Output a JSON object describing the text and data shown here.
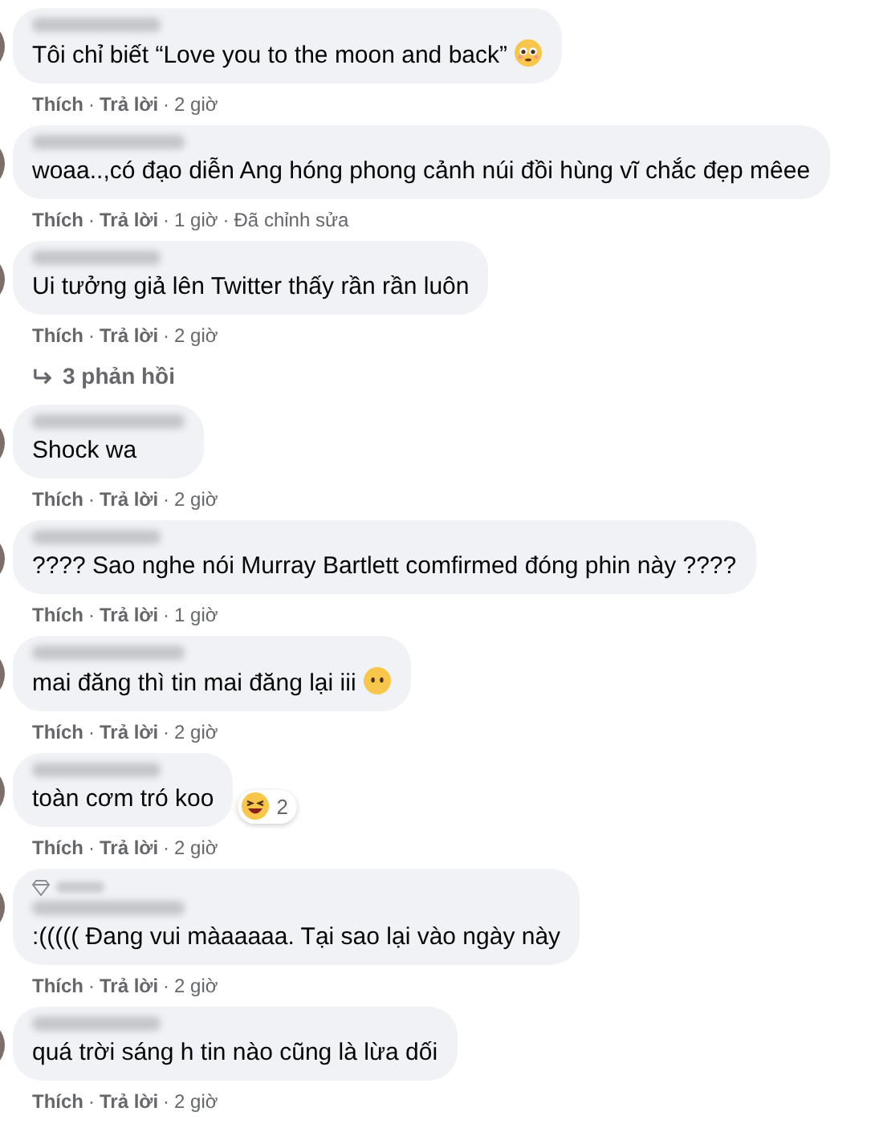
{
  "comments": [
    {
      "text": "Tôi chỉ biết “Love you to the moon and back”",
      "emoji": {
        "kind": "flushed"
      },
      "like": "Thích",
      "reply": "Trả lời",
      "time": "2 giờ",
      "separators": [
        "·",
        "·"
      ]
    },
    {
      "text": "woaa..,có đạo diễn Ang hóng phong cảnh núi đồi hùng vĩ chắc đẹp mêee",
      "like": "Thích",
      "reply": "Trả lời",
      "time": "1 giờ",
      "edited": "Đã chỉnh sửa",
      "separators": [
        "·",
        "·",
        "·"
      ]
    },
    {
      "text": "Ui tưởng giả lên Twitter thấy rần rần luôn",
      "like": "Thích",
      "reply": "Trả lời",
      "time": "2 giờ",
      "separators": [
        "·",
        "·"
      ],
      "replies": "3 phản hồi"
    },
    {
      "text": "Shock wa",
      "like": "Thích",
      "reply": "Trả lời",
      "time": "2 giờ",
      "separators": [
        "·",
        "·"
      ]
    },
    {
      "text": "???? Sao nghe nói Murray Bartlett comfirmed đóng phin này ????",
      "like": "Thích",
      "reply": "Trả lời",
      "time": "1 giờ",
      "separators": [
        "·",
        "·"
      ]
    },
    {
      "text": "mai đăng thì tin mai đăng lại iii",
      "emoji": {
        "kind": "blank"
      },
      "like": "Thích",
      "reply": "Trả lời",
      "time": "2 giờ",
      "separators": [
        "·",
        "·"
      ]
    },
    {
      "text": "toàn cơm tró koo",
      "reaction": {
        "kind": "haha",
        "count": "2"
      },
      "like": "Thích",
      "reply": "Trả lời",
      "time": "2 giờ",
      "separators": [
        "·",
        "·"
      ]
    },
    {
      "text": ":((((( Đang vui màaaaaa. Tại sao lại vào ngày này",
      "fan_badge": true,
      "like": "Thích",
      "reply": "Trả lời",
      "time": "2 giờ",
      "separators": [
        "·",
        "·"
      ]
    },
    {
      "text": "quá trời sáng h tin nào cũng là lừa dối",
      "like": "Thích",
      "reply": "Trả lời",
      "time": "2 giờ",
      "separators": [
        "·",
        "·"
      ]
    }
  ]
}
